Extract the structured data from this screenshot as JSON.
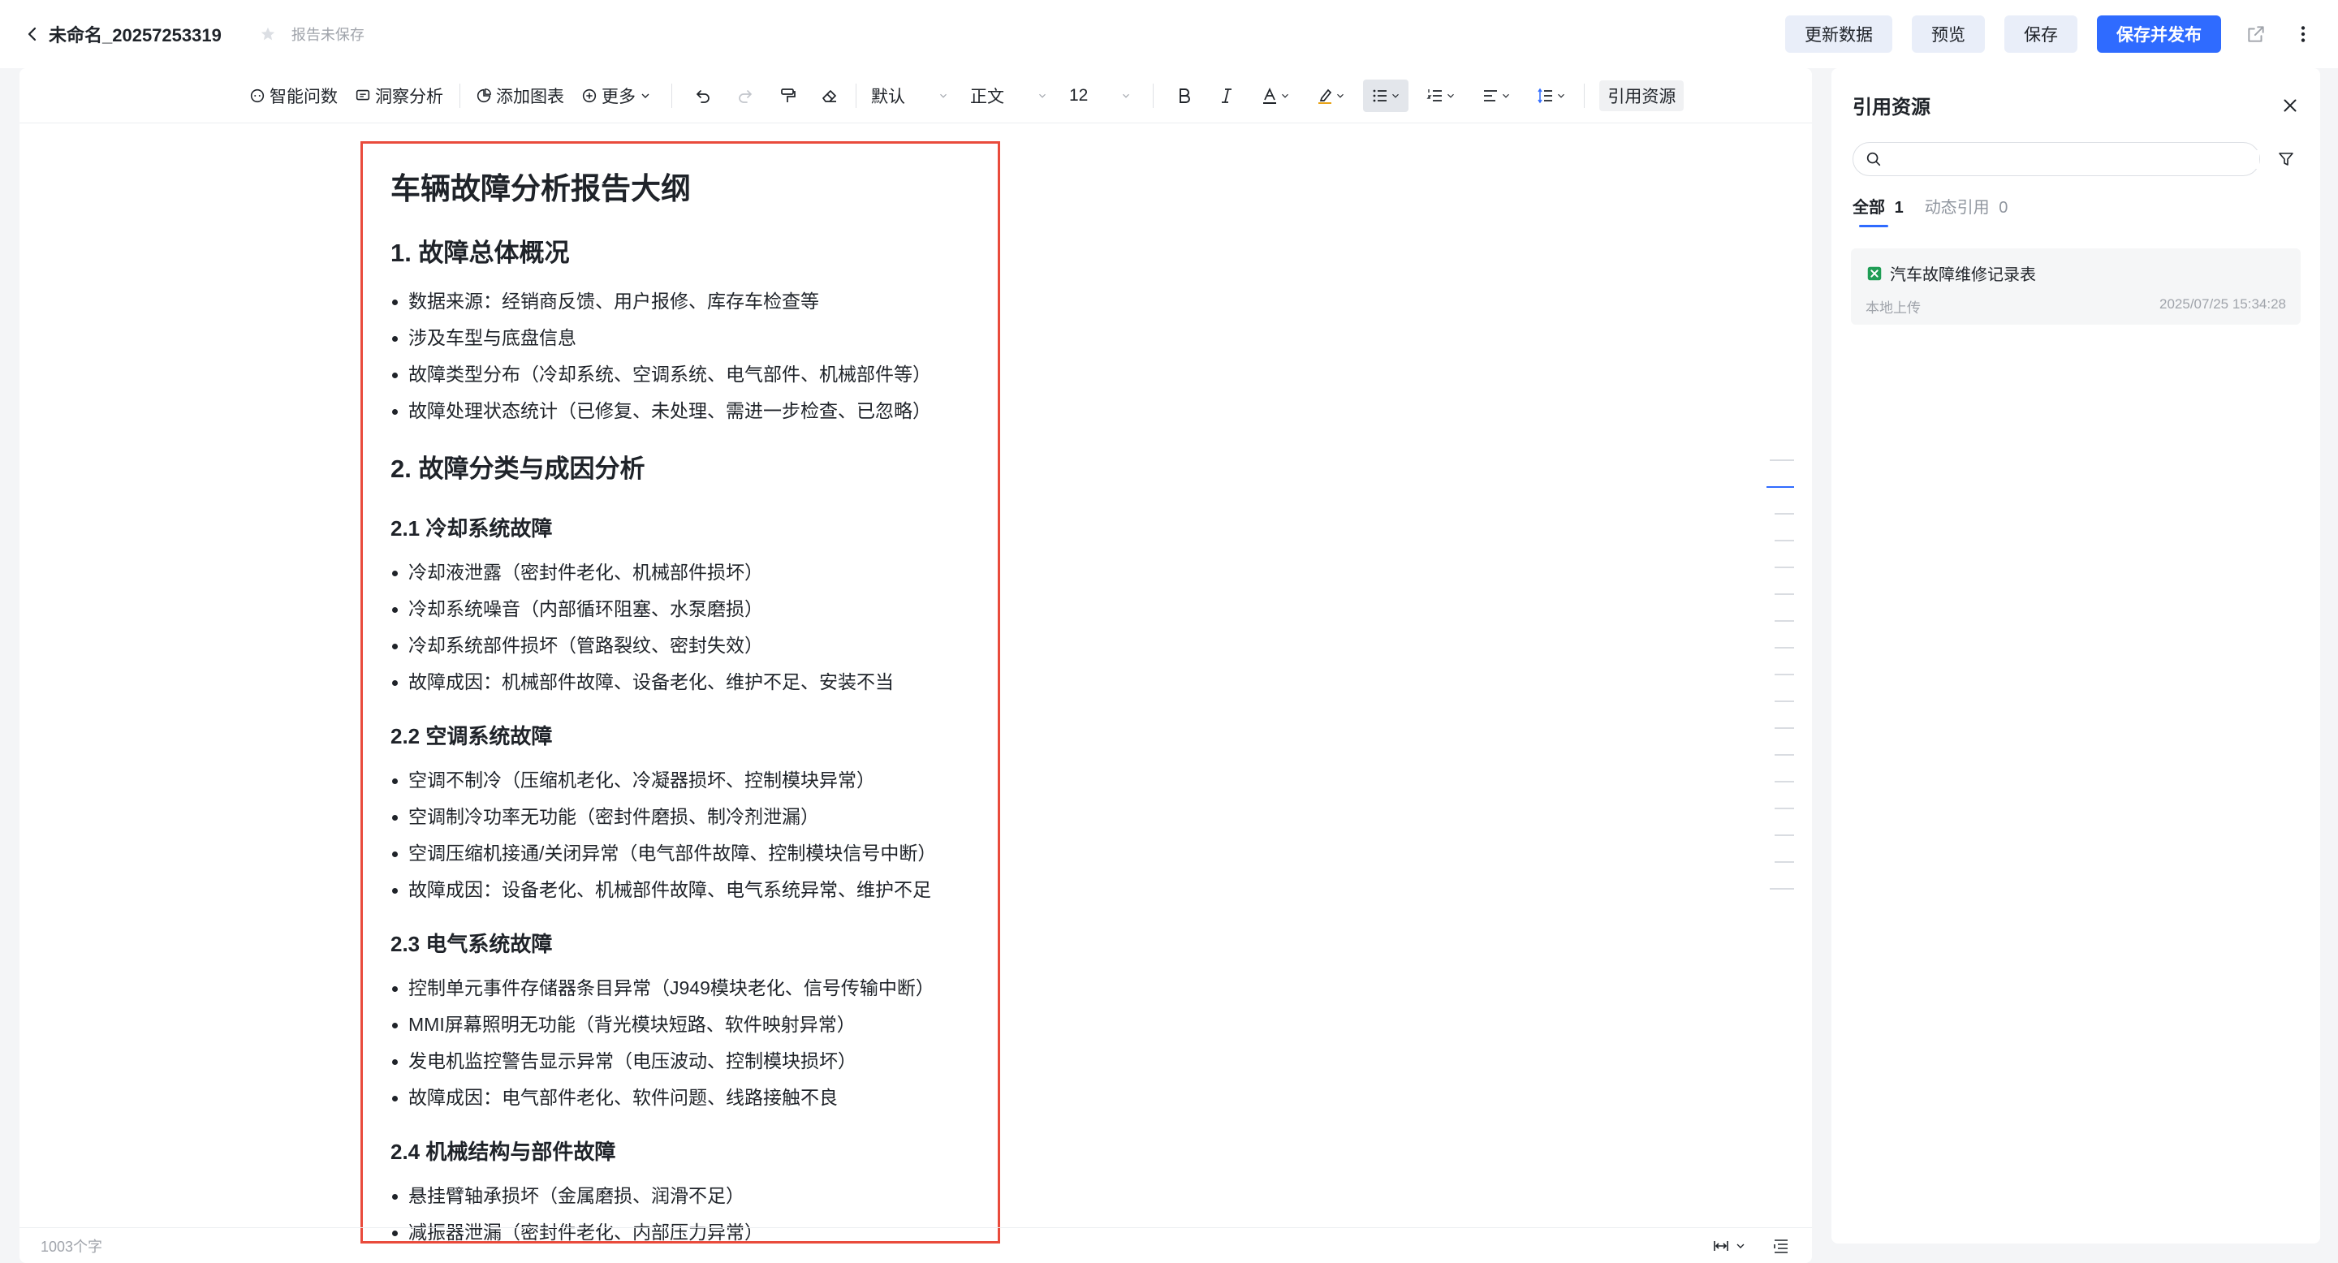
{
  "header": {
    "back_label": "未命名_20257253319",
    "save_status": "报告未保存",
    "buttons": {
      "update": "更新数据",
      "preview": "预览",
      "save": "保存",
      "save_publish": "保存并发布"
    }
  },
  "toolbar": {
    "smart_query": "智能问数",
    "insight": "洞察分析",
    "add_chart": "添加图表",
    "more": "更多",
    "font_family": "默认",
    "paragraph_style": "正文",
    "font_size": "12",
    "ref_resources": "引用资源"
  },
  "document": {
    "title": "车辆故障分析报告大纲",
    "sections": [
      {
        "heading": "1. 故障总体概况",
        "items": [
          "数据来源：经销商反馈、用户报修、库存车检查等",
          "涉及车型与底盘信息",
          "故障类型分布（冷却系统、空调系统、电气部件、机械部件等）",
          "故障处理状态统计（已修复、未处理、需进一步检查、已忽略）"
        ]
      },
      {
        "heading": "2. 故障分类与成因分析",
        "subsections": [
          {
            "heading": "2.1 冷却系统故障",
            "items": [
              "冷却液泄露（密封件老化、机械部件损坏）",
              "冷却系统噪音（内部循环阻塞、水泵磨损）",
              "冷却系统部件损坏（管路裂纹、密封失效）",
              "故障成因：机械部件故障、设备老化、维护不足、安装不当"
            ]
          },
          {
            "heading": "2.2 空调系统故障",
            "items": [
              "空调不制冷（压缩机老化、冷凝器损坏、控制模块异常）",
              "空调制冷功率无功能（密封件磨损、制冷剂泄漏）",
              "空调压缩机接通/关闭异常（电气部件故障、控制模块信号中断）",
              "故障成因：设备老化、机械部件故障、电气系统异常、维护不足"
            ]
          },
          {
            "heading": "2.3 电气系统故障",
            "items": [
              "控制单元事件存储器条目异常（J949模块老化、信号传输中断）",
              "MMI屏幕照明无功能（背光模块短路、软件映射异常）",
              "发电机监控警告显示异常（电压波动、控制模块损坏）",
              "故障成因：电气部件老化、软件问题、线路接触不良"
            ]
          },
          {
            "heading": "2.4 机械结构与部件故障",
            "items": [
              "悬挂臂轴承损坏（金属磨损、润滑不足）",
              "减振器泄漏（密封件老化、内部压力异常）"
            ]
          }
        ]
      }
    ]
  },
  "footer": {
    "word_count": "1003个字"
  },
  "ref_panel": {
    "title": "引用资源",
    "search_placeholder": "",
    "tabs": [
      {
        "label": "全部",
        "count": "1"
      },
      {
        "label": "动态引用",
        "count": "0"
      }
    ],
    "items": [
      {
        "name": "汽车故障维修记录表",
        "source": "本地上传",
        "time": "2025/07/25 15:34:28",
        "icon": "excel-file-icon"
      }
    ]
  },
  "colors": {
    "accent": "#2f6bff",
    "highlight_border": "#e94b3c",
    "excel_green": "#1f9d55"
  }
}
